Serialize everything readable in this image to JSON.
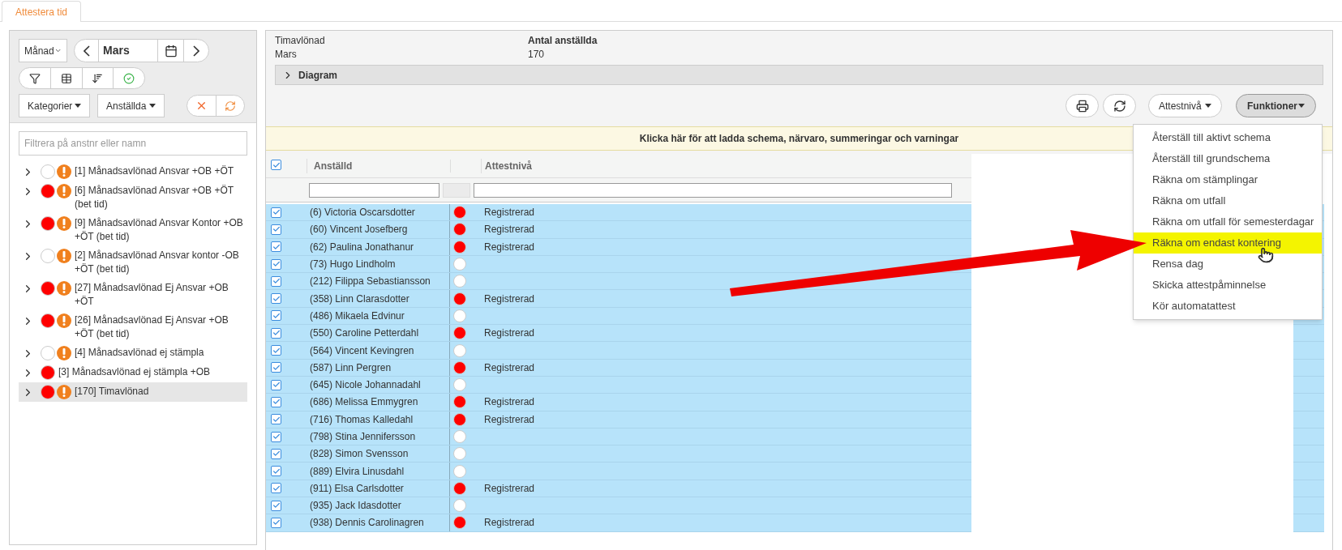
{
  "tabs": [
    {
      "label": "Attestera tid",
      "selected": true
    }
  ],
  "toolbar": {
    "period": "Månad",
    "month": "Mars",
    "category": "Kategorier",
    "employees": "Anställda"
  },
  "filter": {
    "placeholder": "Filtrera på anstnr eller namn"
  },
  "tree": [
    {
      "color": "#ffffff",
      "warning": true,
      "label": "[1]  Månadsavlönad Ansvar +OB +ÖT",
      "selected": false
    },
    {
      "color": "#ff0000",
      "warning": true,
      "label": "[6]  Månadsavlönad Ansvar +OB +ÖT (bet tid)",
      "selected": false
    },
    {
      "color": "#ff0000",
      "warning": true,
      "label": "[9]  Månadsavlönad Ansvar Kontor +OB +ÖT (bet tid)",
      "selected": false
    },
    {
      "color": "#ffffff",
      "warning": true,
      "label": "[2]  Månadsavlönad Ansvar kontor -OB +ÖT (bet tid)",
      "selected": false
    },
    {
      "color": "#ff0000",
      "warning": true,
      "label": "[27]  Månadsavlönad Ej Ansvar +OB +ÖT",
      "selected": false
    },
    {
      "color": "#ff0000",
      "warning": true,
      "label": "[26]  Månadsavlönad Ej Ansvar +OB +ÖT (bet tid)",
      "selected": false
    },
    {
      "color": "#ffffff",
      "warning": true,
      "label": "[4]  Månadsavlönad ej stämpla",
      "selected": false
    },
    {
      "color": "#ff0000",
      "warning": false,
      "label": "[3]  Månadsavlönad ej stämpla +OB",
      "selected": false
    },
    {
      "color": "#ff0000",
      "warning": true,
      "label": "[170]  Timavlönad",
      "selected": true
    }
  ],
  "summary": [
    {
      "label": "Timavlönad",
      "value": "Mars"
    },
    {
      "label": "Antal anställda",
      "value": "170"
    }
  ],
  "diagram": {
    "label": "Diagram",
    "expanded": false
  },
  "buttons": {
    "level": "Attestnivå",
    "functions": "Funktioner"
  },
  "notice": "Klicka här för att ladda schema, närvaro, summeringar och varningar",
  "table": {
    "all_checked": true,
    "columns": [
      "Anställd",
      "Attestnivå"
    ],
    "rows": [
      {
        "checked": true,
        "name": "(6) Victoria Oscarsdotter",
        "color": "#ff0000",
        "level": "Registrerad"
      },
      {
        "checked": true,
        "name": "(60) Vincent Josefberg",
        "color": "#ff0000",
        "level": "Registrerad"
      },
      {
        "checked": true,
        "name": "(62) Paulina Jonathanur",
        "color": "#ff0000",
        "level": "Registrerad"
      },
      {
        "checked": true,
        "name": "(73) Hugo Lindholm",
        "color": "#ffffff"
      },
      {
        "checked": true,
        "name": "(212) Filippa Sebastiansson",
        "color": "#ffffff"
      },
      {
        "checked": true,
        "name": "(358) Linn Clarasdotter",
        "color": "#ff0000",
        "level": "Registrerad"
      },
      {
        "checked": true,
        "name": "(486) Mikaela Edvinur",
        "color": "#ffffff"
      },
      {
        "checked": true,
        "name": "(550) Caroline Petterdahl",
        "color": "#ff0000",
        "level": "Registrerad"
      },
      {
        "checked": true,
        "name": "(564) Vincent Kevingren",
        "color": "#ffffff"
      },
      {
        "checked": true,
        "name": "(587) Linn Pergren",
        "color": "#ff0000",
        "level": "Registrerad"
      },
      {
        "checked": true,
        "name": "(645) Nicole Johannadahl",
        "color": "#ffffff"
      },
      {
        "checked": true,
        "name": "(686) Melissa Emmygren",
        "color": "#ff0000",
        "level": "Registrerad"
      },
      {
        "checked": true,
        "name": "(716) Thomas Kalledahl",
        "color": "#ff0000",
        "level": "Registrerad"
      },
      {
        "checked": true,
        "name": "(798) Stina Jennifersson",
        "color": "#ffffff"
      },
      {
        "checked": true,
        "name": "(828) Simon Svensson",
        "color": "#ffffff"
      },
      {
        "checked": true,
        "name": "(889) Elvira Linusdahl",
        "color": "#ffffff"
      },
      {
        "checked": true,
        "name": "(911) Elsa Carlsdotter",
        "color": "#ff0000",
        "level": "Registrerad"
      },
      {
        "checked": true,
        "name": "(935) Jack Idasdotter",
        "color": "#ffffff"
      },
      {
        "checked": true,
        "name": "(938) Dennis Carolinagren",
        "color": "#ff0000",
        "level": "Registrerad"
      }
    ]
  },
  "menu": [
    {
      "label": "Återställ till aktivt schema",
      "selected": false
    },
    {
      "label": "Återställ till grundschema",
      "selected": false
    },
    {
      "label": "Räkna om stämplingar",
      "selected": false
    },
    {
      "label": "Räkna om utfall",
      "selected": false
    },
    {
      "label": "Räkna om utfall för semesterdagar",
      "selected": false
    },
    {
      "label": "Räkna om endast kontering",
      "selected": true
    },
    {
      "label": "Rensa dag",
      "selected": false
    },
    {
      "label": "Skicka attestpåminnelse",
      "selected": false
    },
    {
      "label": "Kör automatattest",
      "selected": false
    }
  ]
}
